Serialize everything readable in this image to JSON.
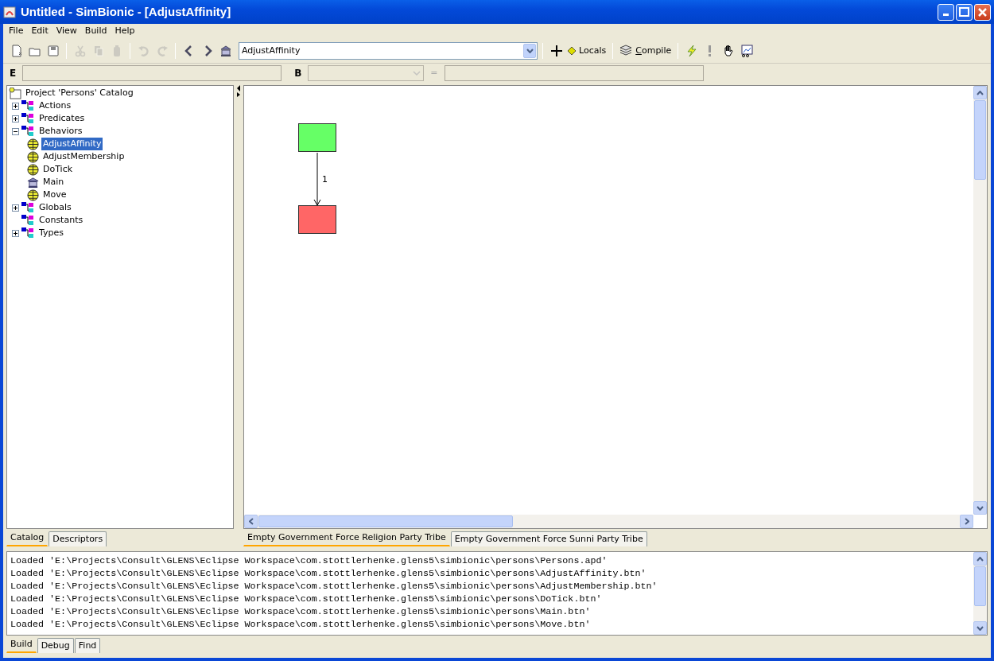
{
  "window": {
    "title": "Untitled - SimBionic - [AdjustAffinity]"
  },
  "menu": [
    "File",
    "Edit",
    "View",
    "Build",
    "Help"
  ],
  "toolbar": {
    "buttons": [
      {
        "disabled": false
      },
      {
        "disabled": false
      },
      {
        "disabled": false
      },
      {
        "disabled": true
      },
      {
        "disabled": true
      },
      {
        "disabled": true
      },
      {
        "disabled": true
      },
      {
        "disabled": true
      },
      {
        "disabled": false
      },
      {
        "disabled": false
      },
      {
        "disabled": false
      }
    ],
    "behavior_select": {
      "value": "AdjustAffinity"
    },
    "text_buttons": [
      "Locals",
      "Compile"
    ]
  },
  "expression_bar": {
    "e_label": "E",
    "b_label": "B",
    "equals_label": "="
  },
  "catalog": {
    "root": "Project 'Persons' Catalog",
    "items": [
      {
        "label": "Actions",
        "kind": "folder",
        "expanded": false,
        "selected": false
      },
      {
        "label": "Predicates",
        "kind": "folder",
        "expanded": false,
        "selected": false
      },
      {
        "label": "Behaviors",
        "kind": "folder",
        "expanded": true,
        "selected": false,
        "children": [
          {
            "label": "AdjustAffinity",
            "kind": "behavior",
            "selected": true
          },
          {
            "label": "AdjustMembership",
            "kind": "behavior",
            "selected": false
          },
          {
            "label": "DoTick",
            "kind": "behavior",
            "selected": false
          },
          {
            "label": "Main",
            "kind": "main",
            "selected": false
          },
          {
            "label": "Move",
            "kind": "behavior",
            "selected": false
          }
        ]
      },
      {
        "label": "Globals",
        "kind": "folder",
        "expanded": false,
        "selected": false
      },
      {
        "label": "Constants",
        "kind": "folder",
        "selected": false
      },
      {
        "label": "Types",
        "kind": "folder",
        "expanded": false,
        "selected": false
      }
    ]
  },
  "catalog_tabs": [
    {
      "label": "Catalog",
      "selected": true
    },
    {
      "label": "Descriptors",
      "selected": false
    }
  ],
  "canvas": {
    "nodes": [
      {
        "color": "#66ff66"
      },
      {
        "color": "#ff6666"
      }
    ],
    "connectors": [
      {
        "label": "1"
      }
    ]
  },
  "canvas_tabs": [
    {
      "label": "Empty Government Force Religion Party Tribe",
      "selected": true
    },
    {
      "label": "Empty Government Force Sunni Party Tribe",
      "selected": false
    }
  ],
  "output": {
    "lines": [
      "Loaded 'E:\\Projects\\Consult\\GLENS\\Eclipse Workspace\\com.stottlerhenke.glens5\\simbionic\\persons\\Persons.apd'",
      "Loaded 'E:\\Projects\\Consult\\GLENS\\Eclipse Workspace\\com.stottlerhenke.glens5\\simbionic\\persons\\AdjustAffinity.btn'",
      "Loaded 'E:\\Projects\\Consult\\GLENS\\Eclipse Workspace\\com.stottlerhenke.glens5\\simbionic\\persons\\AdjustMembership.btn'",
      "Loaded 'E:\\Projects\\Consult\\GLENS\\Eclipse Workspace\\com.stottlerhenke.glens5\\simbionic\\persons\\DoTick.btn'",
      "Loaded 'E:\\Projects\\Consult\\GLENS\\Eclipse Workspace\\com.stottlerhenke.glens5\\simbionic\\persons\\Main.btn'",
      "Loaded 'E:\\Projects\\Consult\\GLENS\\Eclipse Workspace\\com.stottlerhenke.glens5\\simbionic\\persons\\Move.btn'"
    ]
  },
  "output_tabs": [
    {
      "label": "Build",
      "selected": true
    },
    {
      "label": "Debug",
      "selected": false
    },
    {
      "label": "Find",
      "selected": false
    }
  ]
}
